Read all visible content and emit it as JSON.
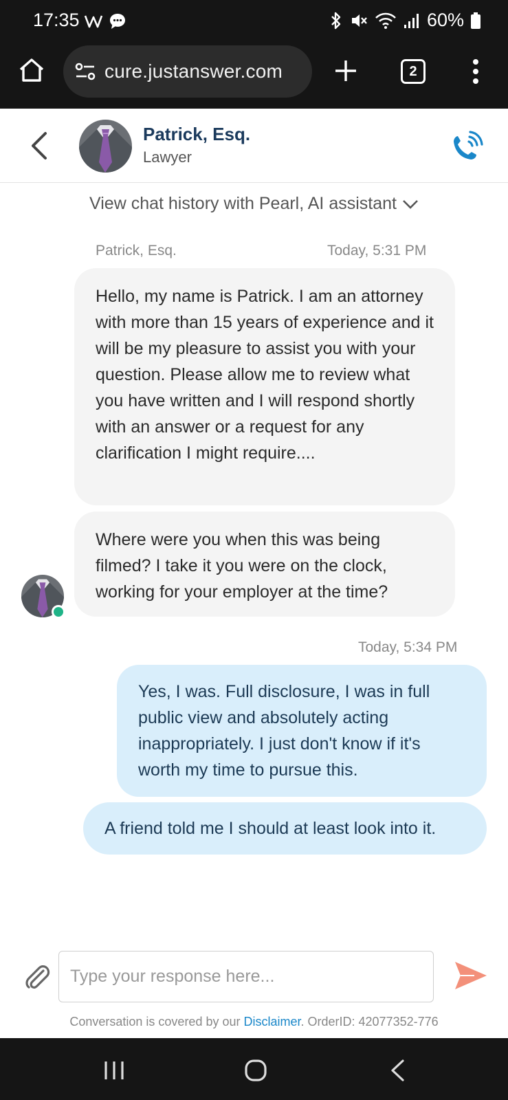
{
  "status_bar": {
    "time": "17:35",
    "notification_icons": [
      "w-app-icon",
      "chat-bubble-icon"
    ],
    "battery": "60%",
    "system_icons": [
      "bluetooth-icon",
      "mute-icon",
      "wifi-icon",
      "signal-icon",
      "battery-icon"
    ]
  },
  "browser": {
    "url": "cure.justanswer.com",
    "tab_count": "2"
  },
  "header": {
    "expert_name": "Patrick, Esq.",
    "expert_role": "Lawyer",
    "call_icon": "phone-ringing-icon"
  },
  "chat": {
    "history_link": "View chat history with Pearl, AI assistant",
    "expert_meta": {
      "sender": "Patrick, Esq.",
      "time": "Today, 5:31 PM"
    },
    "expert_messages": [
      "Hello, my name is Patrick. I am an attorney with more than 15 years of experience and it will be my pleasure to assist you with your question. Please allow me to review what you have written and I will respond shortly with an answer or a request for any clarification I might require....",
      "Where were you when this was being filmed? I take it you were on the clock, working for your employer at the time?"
    ],
    "user_meta": {
      "time": "Today, 5:34 PM"
    },
    "user_messages": [
      "Yes, I was. Full disclosure, I was in full public view and absolutely acting inappropriately. I just don't know if it's worth my time to pursue this.",
      "A friend told me I should at least look into it."
    ]
  },
  "composer": {
    "placeholder": "Type your response here...",
    "value": ""
  },
  "footer": {
    "prefix": "Conversation is covered by our ",
    "disclaimer_link": "Disclaimer",
    "suffix": ". OrderID: 42077352-776"
  },
  "colors": {
    "expert_name": "#1b3a5c",
    "call_icon": "#1a87c9",
    "send_icon": "#f3907a",
    "online_dot": "#1fb387",
    "user_bubble": "#d9eefb",
    "expert_bubble": "#f4f4f4"
  }
}
